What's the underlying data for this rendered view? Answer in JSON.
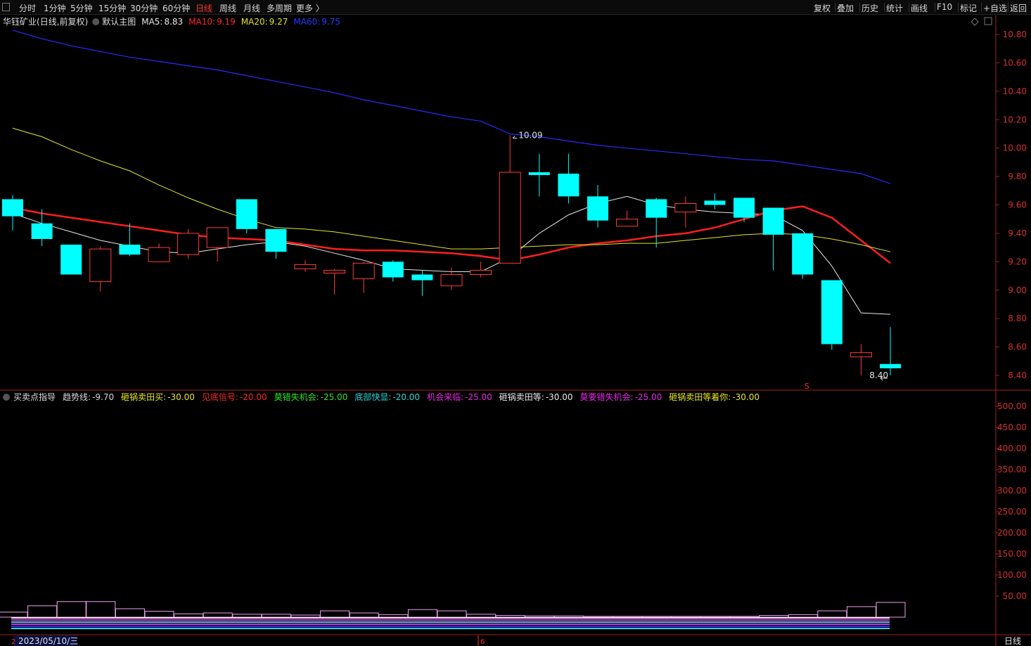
{
  "toolbar": {
    "periods": [
      {
        "label": "分时",
        "active": false
      },
      {
        "label": "1分钟",
        "active": false
      },
      {
        "label": "5分钟",
        "active": false
      },
      {
        "label": "15分钟",
        "active": false
      },
      {
        "label": "30分钟",
        "active": false
      },
      {
        "label": "60分钟",
        "active": false
      },
      {
        "label": "日线",
        "active": true
      },
      {
        "label": "周线",
        "active": false
      },
      {
        "label": "月线",
        "active": false
      },
      {
        "label": "多周期",
        "active": false
      },
      {
        "label": "更多 〉",
        "active": false
      }
    ],
    "actions": [
      "复权",
      "叠加",
      "历史",
      "统计",
      "画线",
      "F10",
      "标记",
      "+自选",
      "返回"
    ]
  },
  "main_legend": {
    "stock": "华钰矿业",
    "mode": "(日线,前复权)",
    "template": "默认主图",
    "ma": [
      {
        "label": "MA5:",
        "value": "8.83",
        "color": "#e8e8e8"
      },
      {
        "label": "MA10:",
        "value": "9.19",
        "color": "#ff2a2a"
      },
      {
        "label": "MA20:",
        "value": "9.27",
        "color": "#e6e62a"
      },
      {
        "label": "MA60:",
        "value": "9.75",
        "color": "#2a36ff"
      }
    ]
  },
  "indicator_legend": {
    "name": "买卖点指导",
    "items": [
      {
        "label": "趋势线:",
        "value": "-9.70",
        "color": "#d8d8d8"
      },
      {
        "label": "砸锅卖田买:",
        "value": "-30.00",
        "color": "#e6e62a"
      },
      {
        "label": "见底信号:",
        "value": "-20.00",
        "color": "#ff2a2a"
      },
      {
        "label": "莫错失机会:",
        "value": "-25.00",
        "color": "#2ae62a"
      },
      {
        "label": "底部快显:",
        "value": "-20.00",
        "color": "#2ad8d8"
      },
      {
        "label": "机会来临:",
        "value": "-25.00",
        "color": "#e62ae6"
      },
      {
        "label": "砸锅卖田等:",
        "value": "-30.00",
        "color": "#e8e8e8"
      },
      {
        "label": "莫要错失机会:",
        "value": "-25.00",
        "color": "#e62ae6"
      },
      {
        "label": "砸锅卖田等着你:",
        "value": "-30.00",
        "color": "#e6e62a"
      }
    ]
  },
  "bottom": {
    "date_label": "2023/05/10/三",
    "marker_left": "2",
    "marker_mid": "6",
    "period_label": "日线"
  },
  "chart_data": [
    {
      "type": "candlestick",
      "ylim": [
        8.3,
        10.9
      ],
      "yticks": [
        "10.80",
        "10.60",
        "10.40",
        "10.20",
        "10.00",
        "9.80",
        "9.60",
        "9.40",
        "9.20",
        "9.00",
        "8.80",
        "8.60",
        "8.40"
      ],
      "annotations": {
        "high_label": "10.09",
        "low_label": "8.40",
        "signal": "S"
      },
      "candles": [
        {
          "o": 9.64,
          "h": 9.67,
          "c": 9.52,
          "l": 9.42
        },
        {
          "o": 9.47,
          "h": 9.57,
          "c": 9.36,
          "l": 9.31
        },
        {
          "o": 9.32,
          "h": 9.32,
          "c": 9.11,
          "l": 9.11
        },
        {
          "o": 9.06,
          "h": 9.31,
          "c": 9.29,
          "l": 8.99
        },
        {
          "o": 9.32,
          "h": 9.47,
          "c": 9.25,
          "l": 9.24
        },
        {
          "o": 9.2,
          "h": 9.33,
          "c": 9.3,
          "l": 9.2
        },
        {
          "o": 9.25,
          "h": 9.43,
          "c": 9.4,
          "l": 9.22
        },
        {
          "o": 9.3,
          "h": 9.44,
          "c": 9.44,
          "l": 9.2
        },
        {
          "o": 9.64,
          "h": 9.64,
          "c": 9.43,
          "l": 9.4
        },
        {
          "o": 9.43,
          "h": 9.43,
          "c": 9.27,
          "l": 9.22
        },
        {
          "o": 9.15,
          "h": 9.21,
          "c": 9.18,
          "l": 9.13
        },
        {
          "o": 9.12,
          "h": 9.15,
          "c": 9.14,
          "l": 8.97
        },
        {
          "o": 9.08,
          "h": 9.2,
          "c": 9.19,
          "l": 8.98
        },
        {
          "o": 9.2,
          "h": 9.21,
          "c": 9.09,
          "l": 9.06
        },
        {
          "o": 9.11,
          "h": 9.14,
          "c": 9.07,
          "l": 8.96
        },
        {
          "o": 9.03,
          "h": 9.16,
          "c": 9.11,
          "l": 9.0
        },
        {
          "o": 9.11,
          "h": 9.2,
          "c": 9.14,
          "l": 9.09
        },
        {
          "o": 9.19,
          "h": 10.09,
          "c": 9.83,
          "l": 9.19
        },
        {
          "o": 9.83,
          "h": 9.96,
          "c": 9.81,
          "l": 9.66
        },
        {
          "o": 9.82,
          "h": 9.96,
          "c": 9.66,
          "l": 9.61
        },
        {
          "o": 9.66,
          "h": 9.74,
          "c": 9.49,
          "l": 9.44
        },
        {
          "o": 9.45,
          "h": 9.56,
          "c": 9.5,
          "l": 9.45
        },
        {
          "o": 9.64,
          "h": 9.65,
          "c": 9.51,
          "l": 9.3
        },
        {
          "o": 9.55,
          "h": 9.66,
          "c": 9.61,
          "l": 9.44
        },
        {
          "o": 9.63,
          "h": 9.68,
          "c": 9.6,
          "l": 9.57
        },
        {
          "o": 9.65,
          "h": 9.65,
          "c": 9.51,
          "l": 9.48
        },
        {
          "o": 9.58,
          "h": 9.58,
          "c": 9.39,
          "l": 9.14
        },
        {
          "o": 9.4,
          "h": 9.4,
          "c": 9.11,
          "l": 9.08
        },
        {
          "o": 9.07,
          "h": 9.07,
          "c": 8.62,
          "l": 8.58
        },
        {
          "o": 8.53,
          "h": 8.62,
          "c": 8.56,
          "l": 8.4
        },
        {
          "o": 8.48,
          "h": 8.74,
          "c": 8.45,
          "l": 8.4
        }
      ],
      "ma_lines": {
        "MA5": [
          9.54,
          9.47,
          9.41,
          9.35,
          9.31,
          9.27,
          9.26,
          9.29,
          9.32,
          9.34,
          9.31,
          9.26,
          9.21,
          9.15,
          9.14,
          9.13,
          9.13,
          9.23,
          9.4,
          9.53,
          9.61,
          9.66,
          9.6,
          9.57,
          9.55,
          9.54,
          9.53,
          9.42,
          9.17,
          8.84,
          8.83
        ],
        "MA10": [
          9.58,
          9.54,
          9.51,
          9.48,
          9.45,
          9.42,
          9.39,
          9.37,
          9.36,
          9.35,
          9.32,
          9.29,
          9.28,
          9.28,
          9.27,
          9.26,
          9.24,
          9.21,
          9.25,
          9.3,
          9.33,
          9.35,
          9.38,
          9.4,
          9.44,
          9.5,
          9.56,
          9.59,
          9.51,
          9.35,
          9.19
        ],
        "MA20": [
          10.14,
          10.08,
          9.99,
          9.91,
          9.84,
          9.74,
          9.65,
          9.57,
          9.5,
          9.44,
          9.43,
          9.41,
          9.38,
          9.35,
          9.32,
          9.29,
          9.29,
          9.3,
          9.31,
          9.32,
          9.32,
          9.33,
          9.33,
          9.35,
          9.37,
          9.39,
          9.4,
          9.39,
          9.36,
          9.32,
          9.27
        ],
        "MA60": [
          10.83,
          10.77,
          10.72,
          10.68,
          10.64,
          10.61,
          10.58,
          10.55,
          10.51,
          10.47,
          10.43,
          10.39,
          10.34,
          10.3,
          10.26,
          10.22,
          10.19,
          10.1,
          10.08,
          10.05,
          10.02,
          10.0,
          9.98,
          9.96,
          9.94,
          9.92,
          9.91,
          9.88,
          9.85,
          9.82,
          9.75
        ]
      }
    },
    {
      "type": "bar",
      "title": "买卖点指导",
      "ylim": [
        0,
        520
      ],
      "yticks": [
        "500.00",
        "450.00",
        "400.00",
        "350.00",
        "300.00",
        "250.00",
        "200.00",
        "150.00",
        "100.00",
        "50.00"
      ],
      "values": [
        12,
        27,
        37,
        37,
        20,
        14,
        8,
        10,
        7,
        7,
        5,
        15,
        10,
        6,
        18,
        15,
        7,
        4,
        3,
        3,
        2,
        2,
        2,
        2,
        2,
        2,
        4,
        6,
        15,
        25,
        35
      ]
    }
  ]
}
